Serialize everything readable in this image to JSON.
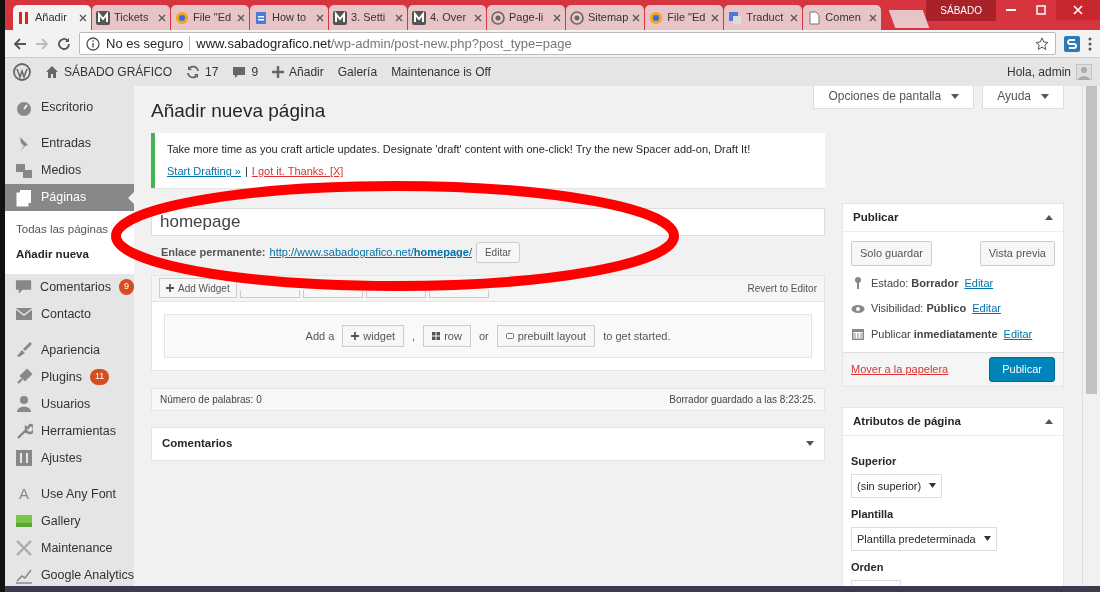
{
  "browser": {
    "tabs": [
      {
        "label": "Añadir",
        "selected": true
      },
      {
        "label": "Tickets",
        "selected": false
      },
      {
        "label": "File \"Ed",
        "selected": false
      },
      {
        "label": "How to",
        "selected": false
      },
      {
        "label": "3. Setti",
        "selected": false
      },
      {
        "label": "4. Over",
        "selected": false
      },
      {
        "label": "Page-li",
        "selected": false
      },
      {
        "label": "Sitemap",
        "selected": false
      },
      {
        "label": "File \"Ed",
        "selected": false
      },
      {
        "label": "Traduct",
        "selected": false
      },
      {
        "label": "Comen",
        "selected": false
      }
    ],
    "profile": "SÁBADO",
    "address": {
      "security": "No es seguro",
      "host": "www.sabadografico.net",
      "path": "/wp-admin/post-new.php?post_type=page"
    }
  },
  "admin_bar": {
    "site": "SÁBADO GRÁFICO",
    "updates": "17",
    "comments": "9",
    "items": [
      "Añadir",
      "Galería",
      "Maintenance is Off"
    ],
    "greeting": "Hola, admin"
  },
  "sidebar": {
    "groups": [
      {
        "items": [
          {
            "label": "Escritorio",
            "selected": false
          }
        ]
      },
      {
        "items": [
          {
            "label": "Entradas",
            "selected": false
          },
          {
            "label": "Medios",
            "selected": false
          },
          {
            "label": "Páginas",
            "selected": true,
            "children": [
              {
                "label": "Todas las páginas",
                "selected": false
              },
              {
                "label": "Añadir nueva",
                "selected": true
              }
            ]
          },
          {
            "label": "Comentarios",
            "selected": false,
            "badge": "9"
          },
          {
            "label": "Contacto",
            "selected": false
          }
        ]
      },
      {
        "items": [
          {
            "label": "Apariencia",
            "selected": false
          },
          {
            "label": "Plugins",
            "selected": false,
            "badge": "11"
          },
          {
            "label": "Usuarios",
            "selected": false
          },
          {
            "label": "Herramientas",
            "selected": false
          },
          {
            "label": "Ajustes",
            "selected": false
          }
        ]
      },
      {
        "items": [
          {
            "label": "Use Any Font",
            "selected": false,
            "icon_text": "A"
          },
          {
            "label": "Gallery",
            "selected": false
          },
          {
            "label": "Maintenance",
            "selected": false
          },
          {
            "label": "Google Analytics",
            "selected": false
          }
        ]
      }
    ]
  },
  "screen_options": "Opciones de pantalla",
  "help": "Ayuda",
  "heading": "Añadir nueva página",
  "notice": {
    "text": "Take more time as you craft article updates. Designate 'draft' content with one-click! Try the new Spacer add-on, Draft It!",
    "links": [
      {
        "label": "Start Drafting »",
        "kind": "primary"
      },
      {
        "label": "I got it. Thanks. [X]",
        "kind": "dismiss"
      }
    ],
    "separator": "|"
  },
  "title_field": {
    "value": "homepage"
  },
  "permalink": {
    "label": "Enlace permanente:",
    "url": "http://www.sabadografico.net/**homepage**/",
    "button": "Editar"
  },
  "builder": {
    "toolbar": [
      {
        "kind": "labeled",
        "label": "Add Widget"
      },
      {
        "kind": "covered"
      },
      {
        "kind": "covered"
      },
      {
        "kind": "covered"
      },
      {
        "kind": "covered"
      }
    ],
    "revert": "Revert to Editor",
    "prompt": [
      {
        "kind": "text",
        "text": "Add a"
      },
      {
        "kind": "button",
        "text": "widget"
      },
      {
        "kind": "text",
        "text": ","
      },
      {
        "kind": "button",
        "text": "row"
      },
      {
        "kind": "text",
        "text": "or"
      },
      {
        "kind": "button",
        "text": "prebuilt layout"
      },
      {
        "kind": "text",
        "text": "to get started."
      }
    ]
  },
  "status": {
    "word_count": "Número de palabras: 0",
    "saved": "Borrador guardado a las 8:23:25."
  },
  "comments_box": {
    "title": "Comentarios"
  },
  "publish_box": {
    "title": "Publicar",
    "save": "Solo guardar",
    "preview": "Vista previa",
    "rows": [
      {
        "text": "Estado: **Borrador**",
        "link": "Editar"
      },
      {
        "text": "Visibilidad: **Público**",
        "link": "Editar"
      },
      {
        "text": "Publicar **inmediatamente**",
        "link": "Editar"
      }
    ],
    "trash": "Mover a la papelera",
    "publish": "Publicar"
  },
  "attributes_box": {
    "title": "Atributos de página",
    "fields": [
      {
        "kind": "select",
        "label": "Superior",
        "value": "(sin superior)"
      },
      {
        "kind": "select",
        "label": "Plantilla",
        "value": "Plantilla predeterminada"
      },
      {
        "kind": "input",
        "label": "Orden"
      }
    ]
  }
}
